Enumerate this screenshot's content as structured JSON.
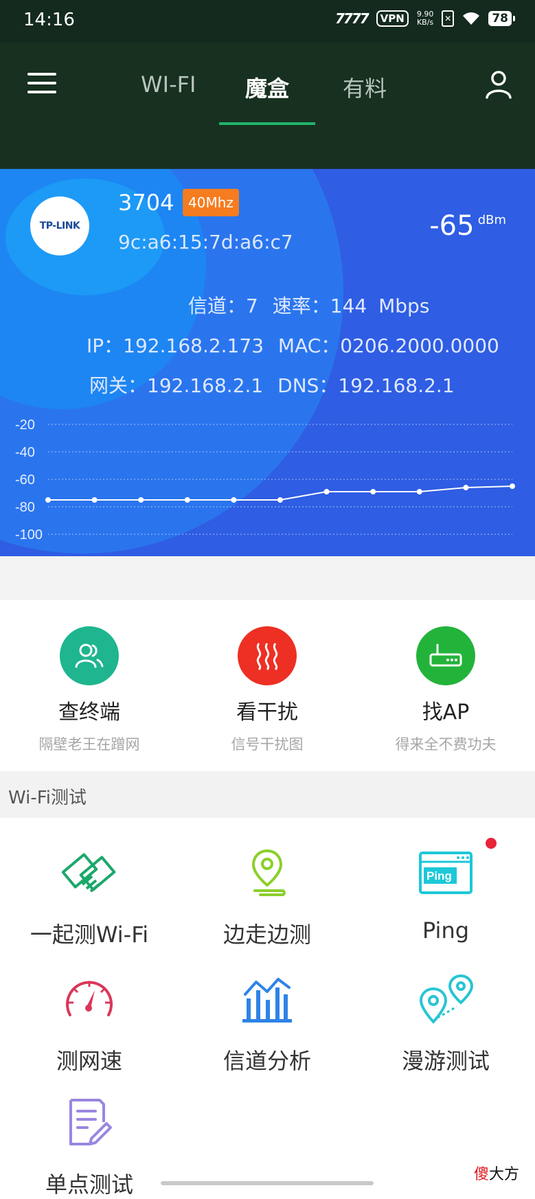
{
  "status_bar": {
    "time": "14:16",
    "signal": "7777",
    "vpn": "VPN",
    "speed_value": "9.90",
    "speed_unit": "KB/s",
    "battery": "78"
  },
  "nav": {
    "tabs": [
      {
        "label": "WI-FI"
      },
      {
        "label": "魔盒"
      },
      {
        "label": "有料"
      }
    ],
    "active_tab": "魔盒"
  },
  "wifi": {
    "logo_text": "TP-LINK",
    "ssid": "3704",
    "band": "40Mhz",
    "bssid": "9c:a6:15:7d:a6:c7",
    "rssi_value": "-65",
    "rssi_unit": "dBm",
    "channel_label": "信道：",
    "channel": "7",
    "rate_label": "速率：",
    "rate": "144",
    "rate_unit": "Mbps",
    "ip_label": "IP：",
    "ip": "192.168.2.173",
    "mac_label": "MAC：",
    "mac": "0206.2000.0000",
    "gateway_label": "网关：",
    "gateway": "192.168.2.1",
    "dns_label": "DNS：",
    "dns": "192.168.2.1"
  },
  "chart_data": {
    "type": "line",
    "x": [
      1,
      2,
      3,
      4,
      5,
      6,
      7,
      8,
      9,
      10,
      11
    ],
    "series": [
      {
        "values": [
          -75,
          -75,
          -75,
          -75,
          -75,
          -75,
          -69,
          -69,
          -69,
          -66,
          -65
        ]
      }
    ],
    "y_ticks": [
      "-20",
      "-40",
      "-60",
      "-80",
      "-100"
    ],
    "ylim": [
      -100,
      -20
    ],
    "grid": "dotted horizontal",
    "title": "",
    "xlabel": "",
    "ylabel": ""
  },
  "features": [
    {
      "title": "查终端",
      "subtitle": "隔壁老王在蹭网",
      "color": "#1fb58e",
      "icon": "users-icon"
    },
    {
      "title": "看干扰",
      "subtitle": "信号干扰图",
      "color": "#ee2f24",
      "icon": "heat-waves-icon"
    },
    {
      "title": "找AP",
      "subtitle": "得来全不费功夫",
      "color": "#23b33a",
      "icon": "router-icon"
    }
  ],
  "section": {
    "title": "Wi-Fi测试"
  },
  "tools": [
    {
      "label": "一起测Wi-Fi",
      "icon": "handshake-icon",
      "color": "#1aa86a"
    },
    {
      "label": "边走边测",
      "icon": "location-pin-icon",
      "color": "#8bcf2a"
    },
    {
      "label": "Ping",
      "icon": "ping-window-icon",
      "color": "#1cc8d8"
    },
    {
      "label": "测网速",
      "icon": "speedometer-icon",
      "color": "#d9375a"
    },
    {
      "label": "信道分析",
      "icon": "bar-chart-icon",
      "color": "#2e83e6"
    },
    {
      "label": "漫游测试",
      "icon": "roaming-pins-icon",
      "color": "#28c5d2"
    },
    {
      "label": "单点测试",
      "icon": "document-edit-icon",
      "color": "#9a86e0"
    }
  ],
  "ping_inner_text": "Ping",
  "watermark": {
    "char1": "傻",
    "rest": "大方"
  }
}
